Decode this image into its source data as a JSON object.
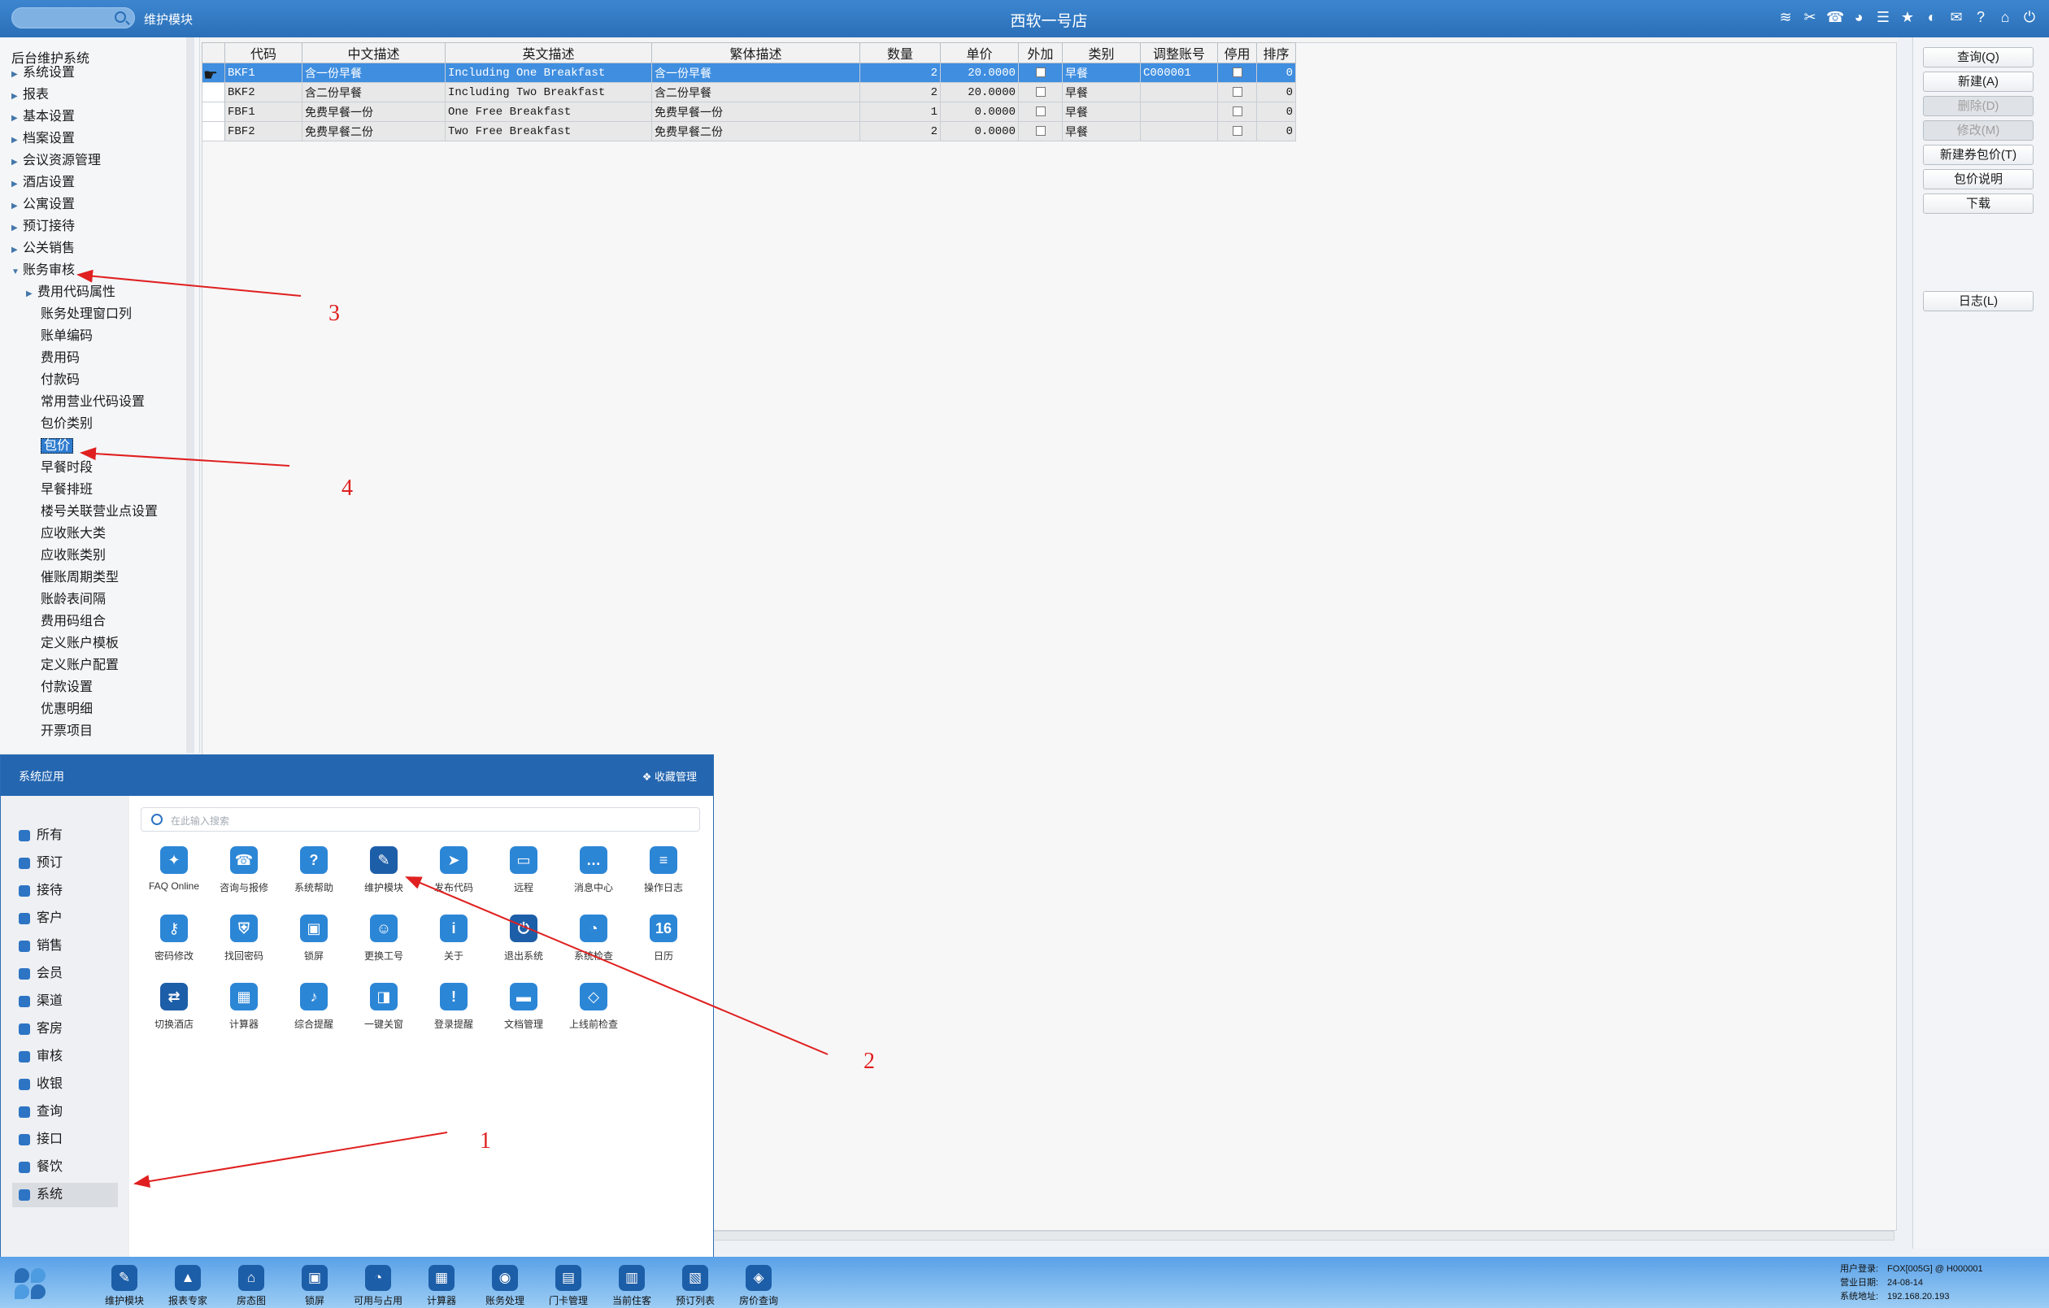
{
  "topbar": {
    "module_name": "维护模块",
    "title": "西软一号店",
    "icons": [
      "wifi-icon",
      "tools-icon",
      "phone-icon",
      "palette-icon",
      "menu-icon",
      "star-icon",
      "contrast-icon",
      "mail-icon",
      "help-icon",
      "home-icon",
      "power-icon"
    ]
  },
  "tree": {
    "title": "后台维护系统",
    "top_items": [
      "系统设置",
      "报表",
      "基本设置",
      "档案设置",
      "会议资源管理",
      "酒店设置",
      "公寓设置",
      "预订接待",
      "公关销售",
      "账务审核"
    ],
    "sub_first": "费用代码属性",
    "sub_items": [
      "账务处理窗口列",
      "账单编码",
      "费用码",
      "付款码",
      "常用营业代码设置",
      "包价类别",
      "包价",
      "早餐时段",
      "早餐排班",
      "楼号关联营业点设置",
      "应收账大类",
      "应收账类别",
      "催账周期类型",
      "账龄表间隔",
      "费用码组合",
      "定义账户模板",
      "定义账户配置",
      "付款设置",
      "优惠明细",
      "开票项目"
    ],
    "selected": "包价"
  },
  "grid": {
    "columns": [
      "代码",
      "中文描述",
      "英文描述",
      "繁体描述",
      "数量",
      "单价",
      "外加",
      "类别",
      "调整账号",
      "停用",
      "排序"
    ],
    "rows": [
      {
        "code": "BKF1",
        "cn": "含一份早餐",
        "en": "Including One Breakfast",
        "tw": "含一份早餐",
        "qty": "2",
        "price": "20.0000",
        "cat": "早餐",
        "acct": "C000001",
        "order": "0"
      },
      {
        "code": "BKF2",
        "cn": "含二份早餐",
        "en": "Including Two Breakfast",
        "tw": "含二份早餐",
        "qty": "2",
        "price": "20.0000",
        "cat": "早餐",
        "acct": "",
        "order": "0"
      },
      {
        "code": "FBF1",
        "cn": "免费早餐一份",
        "en": "One Free Breakfast",
        "tw": "免费早餐一份",
        "qty": "1",
        "price": "0.0000",
        "cat": "早餐",
        "acct": "",
        "order": "0"
      },
      {
        "code": "FBF2",
        "cn": "免费早餐二份",
        "en": "Two Free Breakfast",
        "tw": "免费早餐二份",
        "qty": "2",
        "price": "0.0000",
        "cat": "早餐",
        "acct": "",
        "order": "0"
      }
    ]
  },
  "buttons": {
    "query": "查询(Q)",
    "new": "新建(A)",
    "delete": "删除(D)",
    "modify": "修改(M)",
    "new_coupon": "新建券包价(T)",
    "package_desc": "包价说明",
    "download": "下载",
    "log": "日志(L)"
  },
  "popup": {
    "title": "系统应用",
    "favorites": "收藏管理",
    "search_placeholder": "在此输入搜索",
    "categories": [
      "所有",
      "预订",
      "接待",
      "客户",
      "销售",
      "会员",
      "渠道",
      "客房",
      "审核",
      "收银",
      "查询",
      "接口",
      "餐饮",
      "系统"
    ],
    "active_category": "系统",
    "apps": [
      {
        "label": "FAQ Online",
        "icon": "chat-icon"
      },
      {
        "label": "咨询与报修",
        "icon": "phone-icon"
      },
      {
        "label": "系统帮助",
        "icon": "help-icon"
      },
      {
        "label": "维护模块",
        "icon": "wrench-icon"
      },
      {
        "label": "发布代码",
        "icon": "send-icon"
      },
      {
        "label": "远程",
        "icon": "monitor-icon"
      },
      {
        "label": "消息中心",
        "icon": "message-icon"
      },
      {
        "label": "操作日志",
        "icon": "log-icon"
      },
      {
        "label": "密码修改",
        "icon": "key-icon"
      },
      {
        "label": "找回密码",
        "icon": "shield-icon"
      },
      {
        "label": "锁屏",
        "icon": "lock-icon"
      },
      {
        "label": "更换工号",
        "icon": "user-icon"
      },
      {
        "label": "关于",
        "icon": "info-icon"
      },
      {
        "label": "退出系统",
        "icon": "power-icon"
      },
      {
        "label": "系统检查",
        "icon": "check-icon"
      },
      {
        "label": "日历",
        "icon": "calendar-icon",
        "text": "16"
      },
      {
        "label": "切换酒店",
        "icon": "switch-icon"
      },
      {
        "label": "计算器",
        "icon": "calculator-icon"
      },
      {
        "label": "综合提醒",
        "icon": "bell-icon"
      },
      {
        "label": "一键关窗",
        "icon": "window-icon"
      },
      {
        "label": "登录提醒",
        "icon": "alert-icon"
      },
      {
        "label": "文档管理",
        "icon": "folder-icon"
      },
      {
        "label": "上线前检查",
        "icon": "badge-icon"
      }
    ]
  },
  "dock": {
    "apps": [
      "维护模块",
      "报表专家",
      "房态图",
      "锁屏",
      "可用与占用",
      "计算器",
      "账务处理",
      "门卡管理",
      "当前住客",
      "预订列表",
      "房价查询"
    ],
    "status": {
      "user_label": "用户登录:",
      "user_value": "FOX[005G] @ H000001",
      "date_label": "营业日期:",
      "date_value": "24-08-14",
      "addr_label": "系统地址:",
      "addr_value": "192.168.20.193"
    }
  },
  "annotations": [
    "1",
    "2",
    "3",
    "4"
  ],
  "colors": {
    "accent": "#2466b0",
    "selection": "#3f8ee0",
    "annotation": "#e02020"
  }
}
